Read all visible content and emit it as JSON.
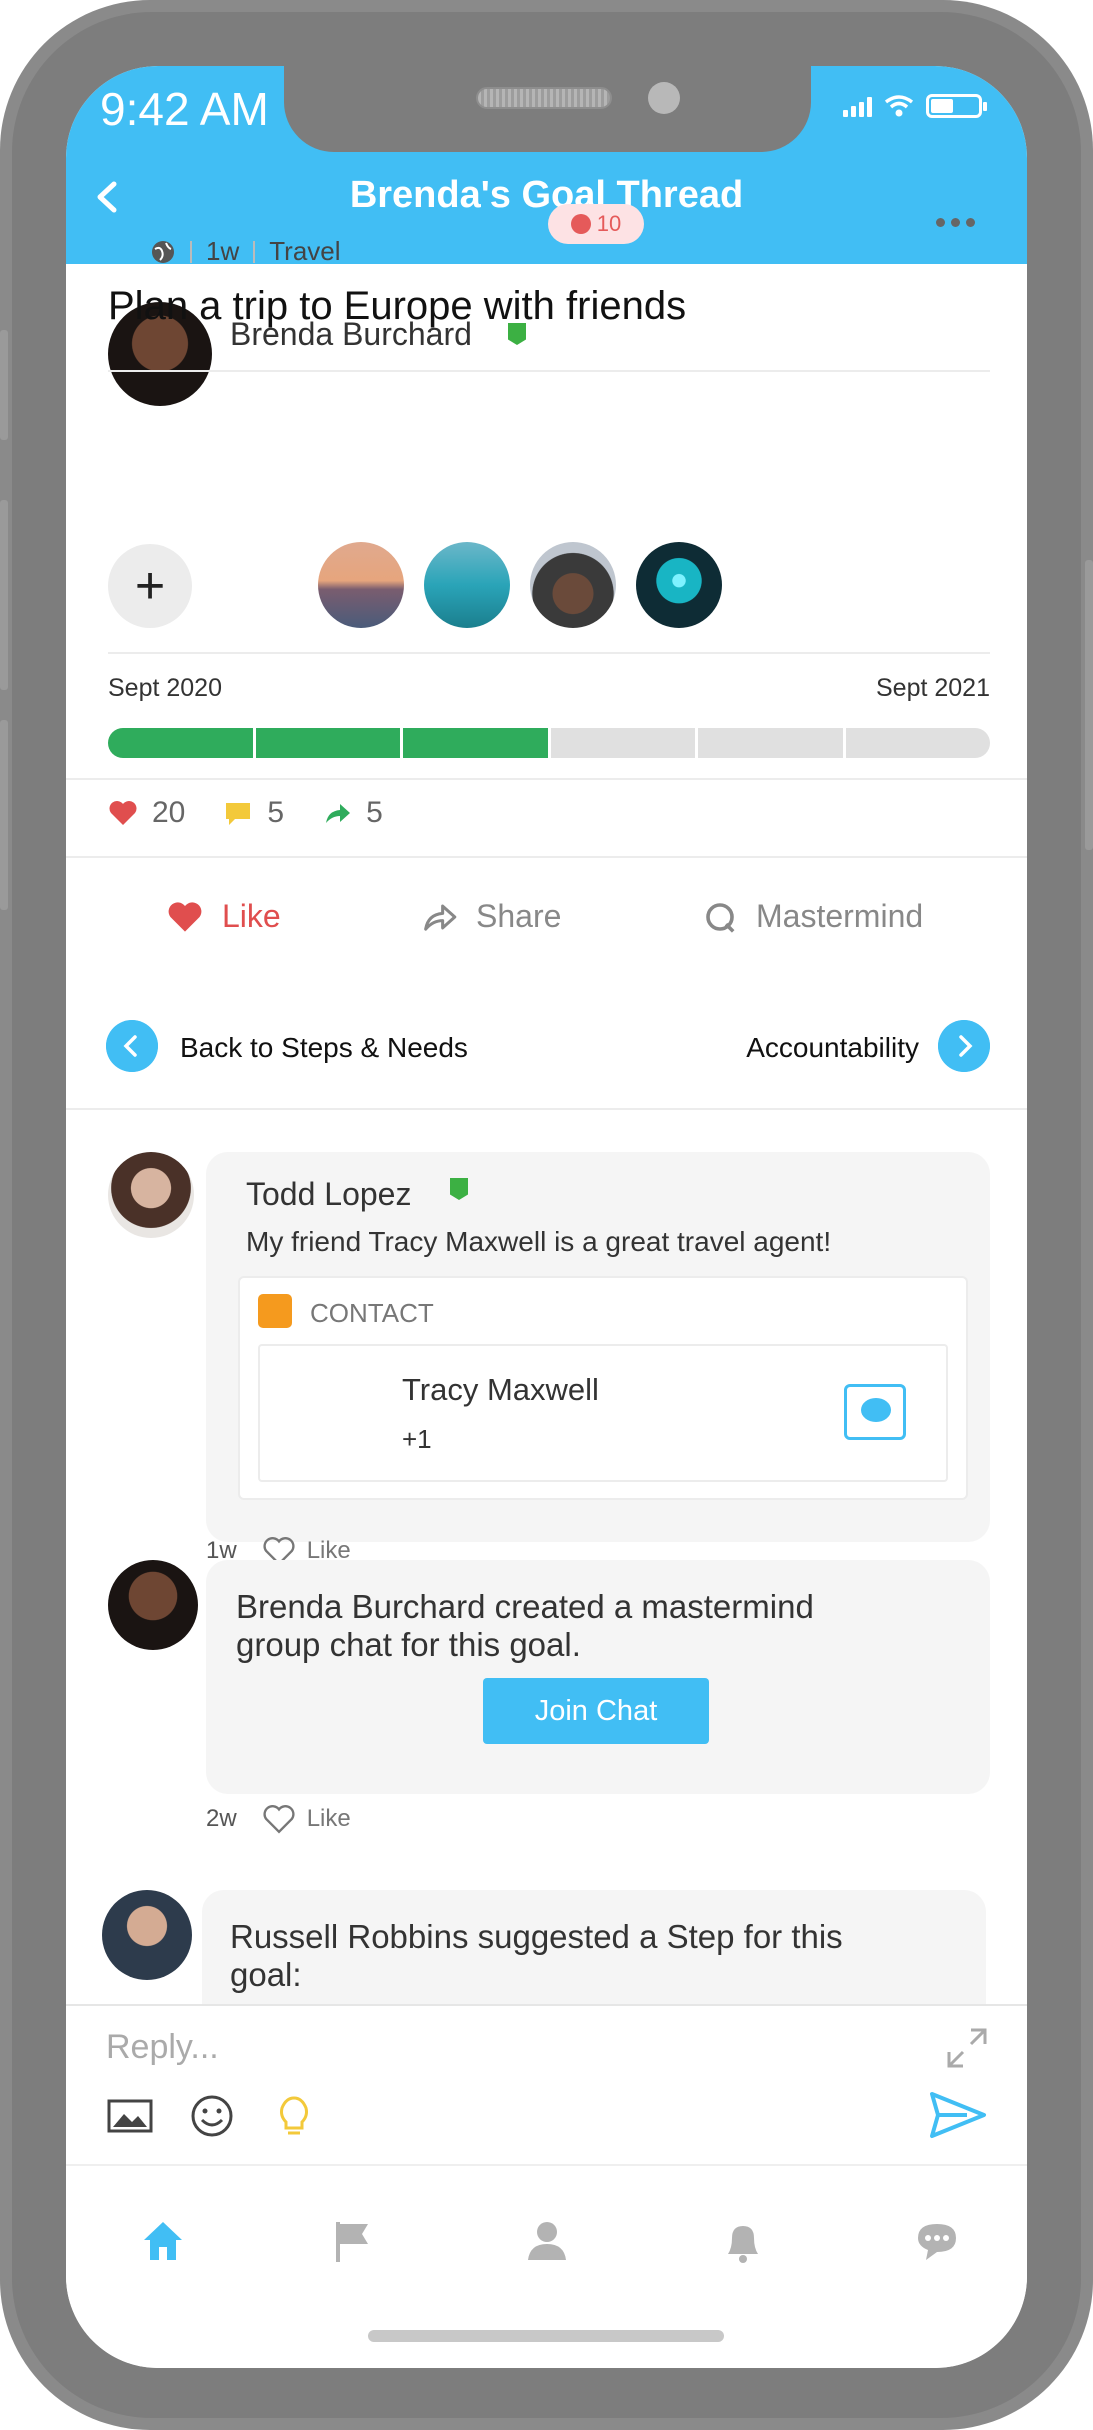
{
  "status_bar": {
    "time": "9:42 AM"
  },
  "header": {
    "title": "Brenda's Goal Thread"
  },
  "post": {
    "author": "Brenda Burchard",
    "streak": "10",
    "time": "1w",
    "category": "Travel",
    "goal": "Plan a trip to Europe with friends",
    "timeline": {
      "start": "Sept 2020",
      "end": "Sept 2021",
      "segments_done": 3,
      "segments_total": 6
    },
    "stats": {
      "likes": "20",
      "comments": "5",
      "shares": "5"
    },
    "actions": {
      "like": "Like",
      "share": "Share",
      "mastermind": "Mastermind"
    },
    "nav": {
      "back": "Back to Steps & Needs",
      "next": "Accountability"
    }
  },
  "comments": [
    {
      "author": "Todd Lopez",
      "text": "My friend Tracy Maxwell is a great travel agent!",
      "contact": {
        "label": "CONTACT",
        "name": "Tracy Maxwell",
        "sub": "+1"
      },
      "time": "1w",
      "like": "Like"
    },
    {
      "author": "Brenda Burchard",
      "text_rest": " created a mastermind",
      "text_line2": "group chat for this goal.",
      "button": "Join Chat",
      "time": "2w",
      "like": "Like"
    },
    {
      "author": "Russell Robbins",
      "text_rest": " suggested a Step for this",
      "text_line2": "goal:"
    }
  ],
  "reply": {
    "placeholder": "Reply..."
  },
  "colors": {
    "accent": "#41bef4",
    "progress": "#2fac5c",
    "like": "#e04e4e",
    "verified": "#3cb043"
  },
  "tabs": [
    "home-icon",
    "flag-icon",
    "profile-icon",
    "bell-icon",
    "chat-icon"
  ]
}
